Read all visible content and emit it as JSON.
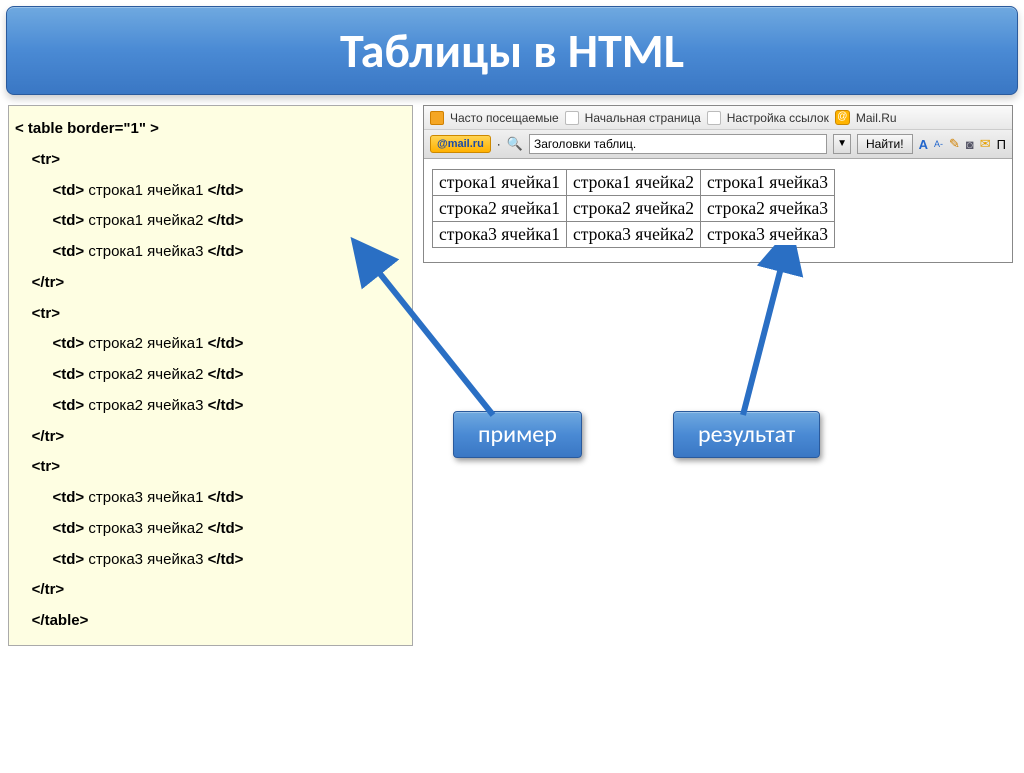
{
  "title": "Таблицы в HTML",
  "code": {
    "l1": "< table border=\"1\" >",
    "l1_indent": "",
    "tr_open": "<tr>",
    "tr_close": "</tr>",
    "td_open": "<td>",
    "td_close": "</td>",
    "table_close": "</table>",
    "cells": [
      [
        "строка1 ячейка1",
        "строка1 ячейка2",
        "строка1 ячейка3"
      ],
      [
        "строка2 ячейка1",
        "строка2 ячейка2",
        "строка2 ячейка3"
      ],
      [
        "строка3 ячейка1",
        "строка3 ячейка2",
        "строка3 ячейка3"
      ]
    ]
  },
  "toolbar": {
    "frequent": "Часто посещаемые",
    "startpage": "Начальная страница",
    "links": "Настройка ссылок",
    "mailru": "Mail.Ru",
    "badge": "@mail.ru",
    "search_icon": "🔍",
    "search_value": "Заголовки таблиц.",
    "find": "Найти!",
    "icon_aa": "A",
    "icon_pencil": "✎",
    "icon_cam": "◙",
    "icon_mail": "✉",
    "icon_p": "П"
  },
  "result_table": [
    [
      "строка1 ячейка1",
      "строка1 ячейка2",
      "строка1 ячейка3"
    ],
    [
      "строка2 ячейка1",
      "строка2 ячейка2",
      "строка2 ячейка3"
    ],
    [
      "строка3 ячейка1",
      "строка3 ячейка2",
      "строка3 ячейка3"
    ]
  ],
  "labels": {
    "example": "пример",
    "result": "результат"
  }
}
